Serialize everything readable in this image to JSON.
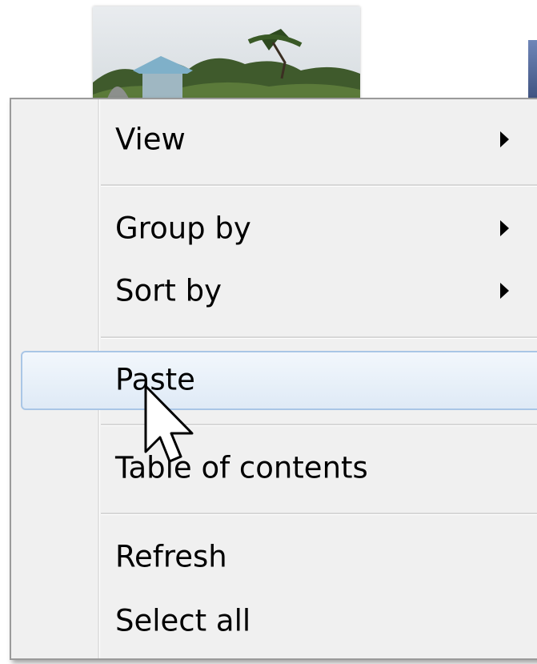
{
  "context_menu": {
    "items": [
      {
        "label": "View",
        "has_submenu": true
      },
      {
        "label": "Group by",
        "has_submenu": true
      },
      {
        "label": "Sort by",
        "has_submenu": true
      },
      {
        "label": "Paste",
        "has_submenu": false,
        "highlighted": true
      },
      {
        "label": "Table of contents",
        "has_submenu": false
      },
      {
        "label": "Refresh",
        "has_submenu": false
      },
      {
        "label": "Select all",
        "has_submenu": false
      }
    ]
  },
  "colors": {
    "menu_background": "#f0f0f0",
    "highlight_border": "#a9c6e6",
    "highlight_fill": "#dfeaf6"
  },
  "icons": {
    "submenu_arrow": "chevron-right-icon",
    "cursor": "mouse-pointer-icon"
  }
}
